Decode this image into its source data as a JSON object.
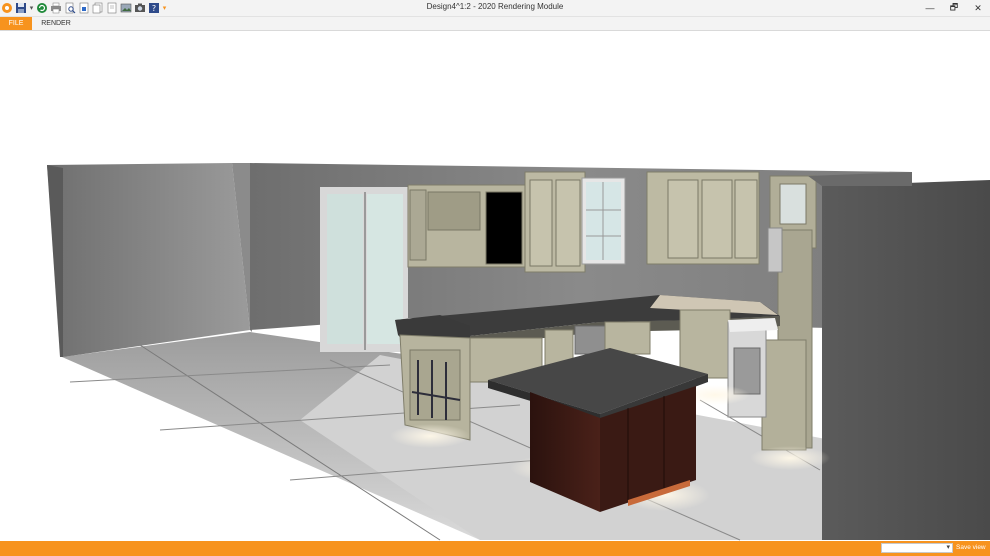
{
  "window": {
    "title": "Design4^1:2 - 2020 Rendering Module",
    "controls": {
      "minimize": "—",
      "restore": "🗗",
      "close": "✕"
    }
  },
  "quick_access": [
    {
      "name": "app-logo-icon"
    },
    {
      "name": "save-icon"
    },
    {
      "name": "refresh-icon"
    },
    {
      "name": "print-icon"
    },
    {
      "name": "print-preview-icon"
    },
    {
      "name": "export-icon"
    },
    {
      "name": "copy-icon"
    },
    {
      "name": "page-icon"
    },
    {
      "name": "image-icon"
    },
    {
      "name": "camera-icon"
    },
    {
      "name": "help-icon"
    }
  ],
  "ribbon": {
    "tabs": [
      {
        "label": "FILE",
        "active": true
      },
      {
        "label": "RENDER",
        "active": false
      }
    ]
  },
  "statusbar": {
    "view_select_value": "",
    "save_view_label": "Save view"
  },
  "colors": {
    "accent": "#f7931e",
    "cabinet": "#b9b7a0",
    "island": "#3a1a15",
    "counter": "#3c3c3c",
    "wall": "#8a8a8a",
    "floor": "#cfcfcf"
  }
}
